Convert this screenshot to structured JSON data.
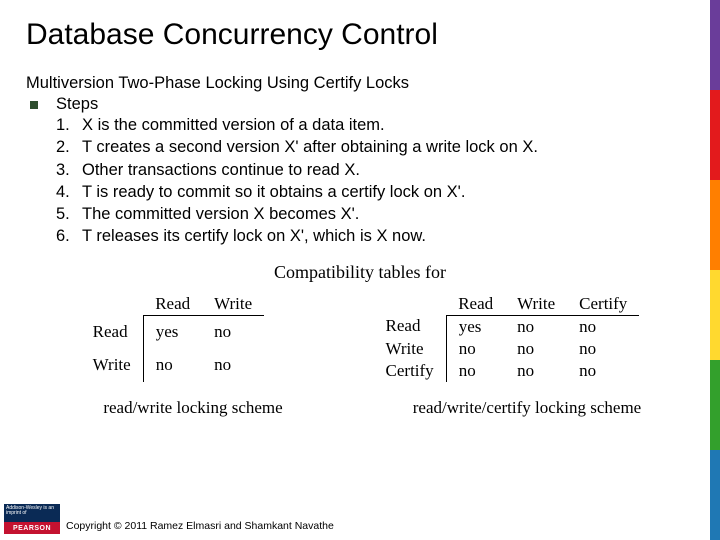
{
  "title": "Database Concurrency Control",
  "subtitle": "Multiversion Two-Phase Locking Using Certify Locks",
  "bullet_label": "Steps",
  "steps": [
    {
      "n": "1.",
      "t": "X is the committed version of a data item."
    },
    {
      "n": "2.",
      "t": "T creates a second version X' after obtaining a write lock on X."
    },
    {
      "n": "3.",
      "t": "Other transactions continue to read X."
    },
    {
      "n": "4.",
      "t": "T is ready to commit so it obtains a certify lock on X'."
    },
    {
      "n": "5.",
      "t": "The committed version X becomes X'."
    },
    {
      "n": "6.",
      "t": "T releases its certify lock on X', which is X now."
    }
  ],
  "compat_heading": "Compatibility tables for",
  "table_rw": {
    "cols": [
      "Read",
      "Write"
    ],
    "rows": [
      {
        "h": "Read",
        "c": [
          "yes",
          "no"
        ]
      },
      {
        "h": "Write",
        "c": [
          "no",
          "no"
        ]
      }
    ],
    "caption": "read/write locking scheme"
  },
  "table_rwc": {
    "cols": [
      "Read",
      "Write",
      "Certify"
    ],
    "rows": [
      {
        "h": "Read",
        "c": [
          "yes",
          "no",
          "no"
        ]
      },
      {
        "h": "Write",
        "c": [
          "no",
          "no",
          "no"
        ]
      },
      {
        "h": "Certify",
        "c": [
          "no",
          "no",
          "no"
        ]
      }
    ],
    "caption": "read/write/certify locking scheme"
  },
  "footer": "Copyright © 2011 Ramez Elmasri and Shamkant Navathe",
  "badge": {
    "top": "Addison-Wesley\nis an imprint of",
    "bottom": "PEARSON"
  },
  "stripe_colors": [
    "#6a3d9a",
    "#e31a1c",
    "#ff7f00",
    "#ffd92f",
    "#33a02c",
    "#1f78b4"
  ]
}
